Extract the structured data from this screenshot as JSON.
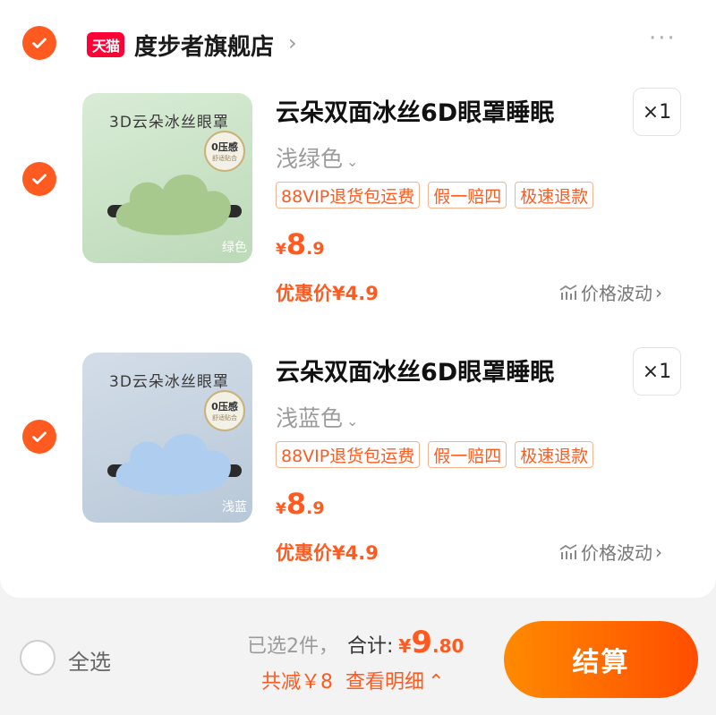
{
  "store": {
    "logo_text": "天猫",
    "name": "度步者旗舰店",
    "more": "···"
  },
  "items": [
    {
      "thumb_title": "3D云朵冰丝眼罩",
      "thumb_badge": "0压感",
      "thumb_badge_sub": "舒适贴合",
      "thumb_tag": "绿色",
      "title": "云朵双面冰丝6D眼罩睡眠",
      "quantity": "×1",
      "variant": "浅绿色",
      "tags": [
        "88VIP退货包运费",
        "假一赔四",
        "极速退款"
      ],
      "price_symbol": "¥",
      "price_int": "8",
      "price_dec": ".9",
      "promo": "优惠价¥4.9",
      "fluct": "价格波动",
      "bg": "#cfe6cf",
      "cloud_color": "#a8c98d"
    },
    {
      "thumb_title": "3D云朵冰丝眼罩",
      "thumb_badge": "0压感",
      "thumb_badge_sub": "舒适贴合",
      "thumb_tag": "浅蓝",
      "title": "云朵双面冰丝6D眼罩睡眠",
      "quantity": "×1",
      "variant": "浅蓝色",
      "tags": [
        "88VIP退货包运费",
        "假一赔四",
        "极速退款"
      ],
      "price_symbol": "¥",
      "price_int": "8",
      "price_dec": ".9",
      "promo": "优惠价¥4.9",
      "fluct": "价格波动",
      "bg": "#c5d3e0",
      "cloud_color": "#aecdef"
    }
  ],
  "footer": {
    "select_all": "全选",
    "selected_count": "已选2件，",
    "total_label": "合计:",
    "total_symbol": "¥",
    "total_int": "9",
    "total_dec": ".80",
    "discount": "共减￥8",
    "details": "查看明细",
    "checkout": "结算"
  },
  "colors": {
    "accent": "#ff5a1f",
    "checkout_gradient_start": "#ff8a00",
    "checkout_gradient_end": "#ff4d00"
  }
}
